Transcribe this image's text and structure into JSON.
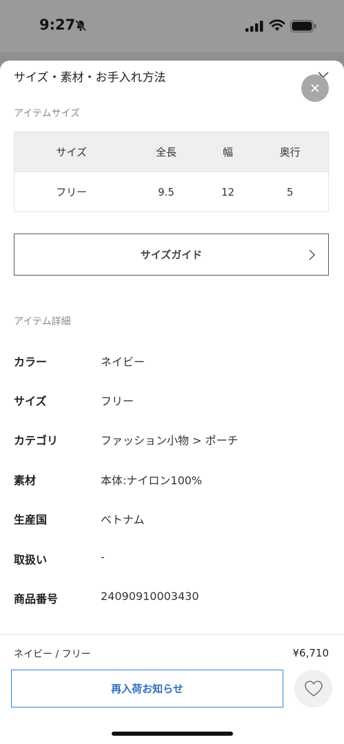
{
  "status": {
    "time": "9:27"
  },
  "sheet": {
    "title": "サイズ・素材・お手入れ方法",
    "size_section_label": "アイテムサイズ",
    "size_table": {
      "headers": [
        "サイズ",
        "全長",
        "幅",
        "奥行"
      ],
      "rows": [
        [
          "フリー",
          "9.5",
          "12",
          "5"
        ]
      ]
    },
    "size_guide_label": "サイズガイド",
    "details_section_label": "アイテム詳細",
    "details": [
      {
        "key": "カラー",
        "value": "ネイビー"
      },
      {
        "key": "サイズ",
        "value": "フリー"
      },
      {
        "key": "カテゴリ",
        "value": "ファッション小物 > ポーチ"
      },
      {
        "key": "素材",
        "value": "本体:ナイロン100%"
      },
      {
        "key": "生産国",
        "value": "ベトナム"
      },
      {
        "key": "取扱い",
        "value": "-"
      },
      {
        "key": "商品番号",
        "value": "24090910003430"
      }
    ]
  },
  "footer": {
    "variant": "ネイビー / フリー",
    "price": "¥6,710",
    "restock_label": "再入荷お知らせ"
  },
  "icons": {
    "mute": "bell-slash-icon",
    "signal": "signal-icon",
    "wifi": "wifi-icon",
    "battery": "battery-icon",
    "close": "close-icon",
    "chevron": "chevron-right-icon",
    "favorite": "heart-icon"
  },
  "colors": {
    "accent": "#2f7ed8",
    "close_bg": "#a8a8a8"
  }
}
